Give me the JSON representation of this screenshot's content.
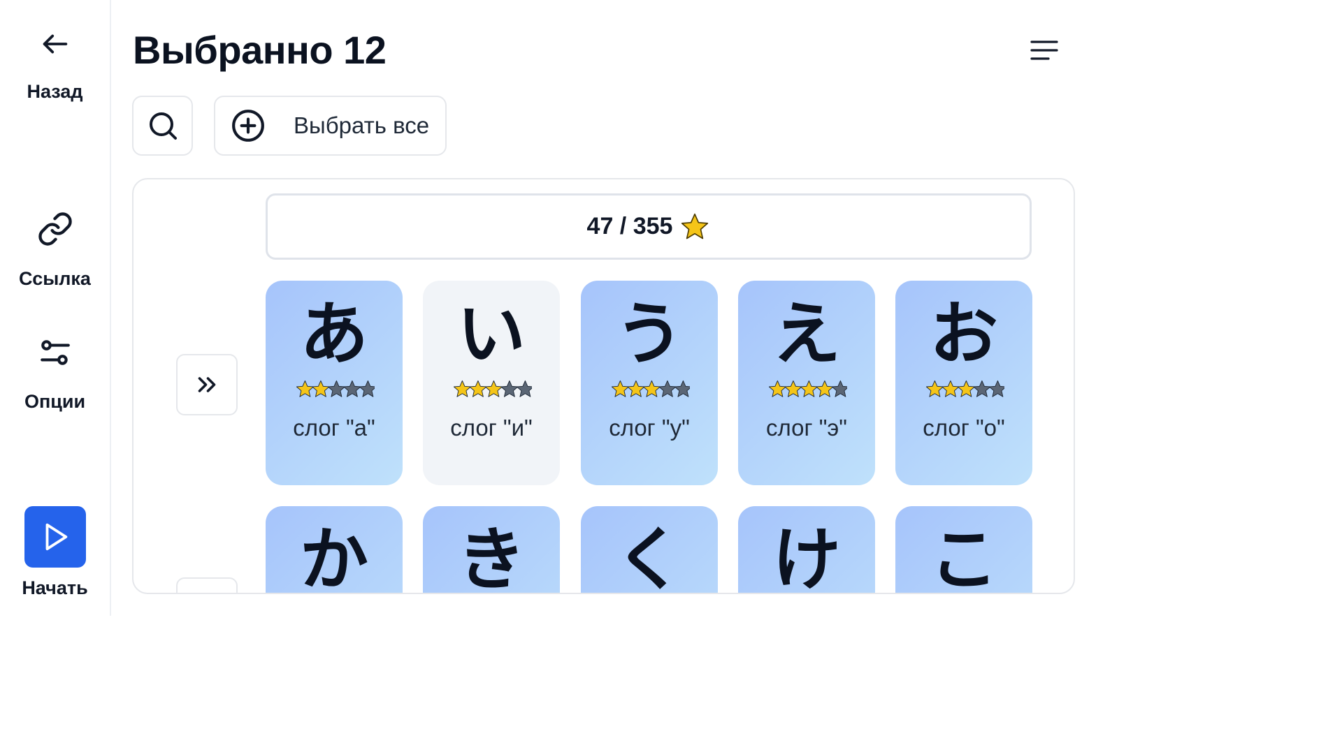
{
  "sidebar": {
    "back_label": "Назад",
    "link_label": "Ссылка",
    "options_label": "Опции",
    "start_label": "Начать"
  },
  "header": {
    "title": "Выбранно 12"
  },
  "toolbar": {
    "select_all_label": "Выбрать все"
  },
  "progress": {
    "text": "47 / 355"
  },
  "colors": {
    "accent": "#2563eb",
    "star_on": "#f5c518",
    "star_off": "#5b6675"
  },
  "cards": [
    {
      "kana": "あ",
      "label": "слог \"а\"",
      "stars": 2,
      "selected": true
    },
    {
      "kana": "い",
      "label": "слог \"и\"",
      "stars": 3,
      "selected": false
    },
    {
      "kana": "う",
      "label": "слог \"у\"",
      "stars": 3,
      "selected": true
    },
    {
      "kana": "え",
      "label": "слог \"э\"",
      "stars": 4,
      "selected": true
    },
    {
      "kana": "お",
      "label": "слог \"о\"",
      "stars": 3,
      "selected": true
    },
    {
      "kana": "か",
      "label": "",
      "stars": 0,
      "selected": true
    },
    {
      "kana": "き",
      "label": "",
      "stars": 0,
      "selected": true
    },
    {
      "kana": "く",
      "label": "",
      "stars": 0,
      "selected": true
    },
    {
      "kana": "け",
      "label": "",
      "stars": 0,
      "selected": true
    },
    {
      "kana": "こ",
      "label": "",
      "stars": 0,
      "selected": true
    }
  ]
}
